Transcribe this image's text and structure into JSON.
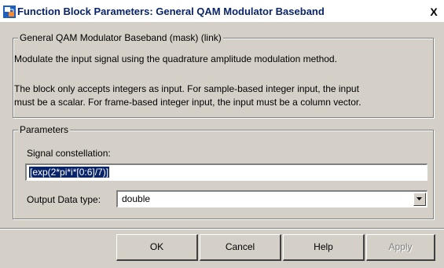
{
  "window": {
    "title": "Function Block Parameters: General QAM Modulator Baseband",
    "close_glyph": "X"
  },
  "mask_group": {
    "legend": "General QAM Modulator Baseband (mask) (link)",
    "description_line1": "Modulate the input signal using the quadrature amplitude modulation method.",
    "description_line2": "The block only accepts integers as input. For sample-based integer input, the input",
    "description_line3": "must be a scalar. For frame-based integer input, the input must be a column vector."
  },
  "parameters_group": {
    "legend": "Parameters",
    "signal_constellation_label": "Signal constellation:",
    "signal_constellation_value": "[exp(2*pi*i*[0:6]/7)]",
    "output_type_label": "Output Data type:",
    "output_type_value": "double"
  },
  "buttons": {
    "ok": "OK",
    "cancel": "Cancel",
    "help": "Help",
    "apply": "Apply"
  }
}
